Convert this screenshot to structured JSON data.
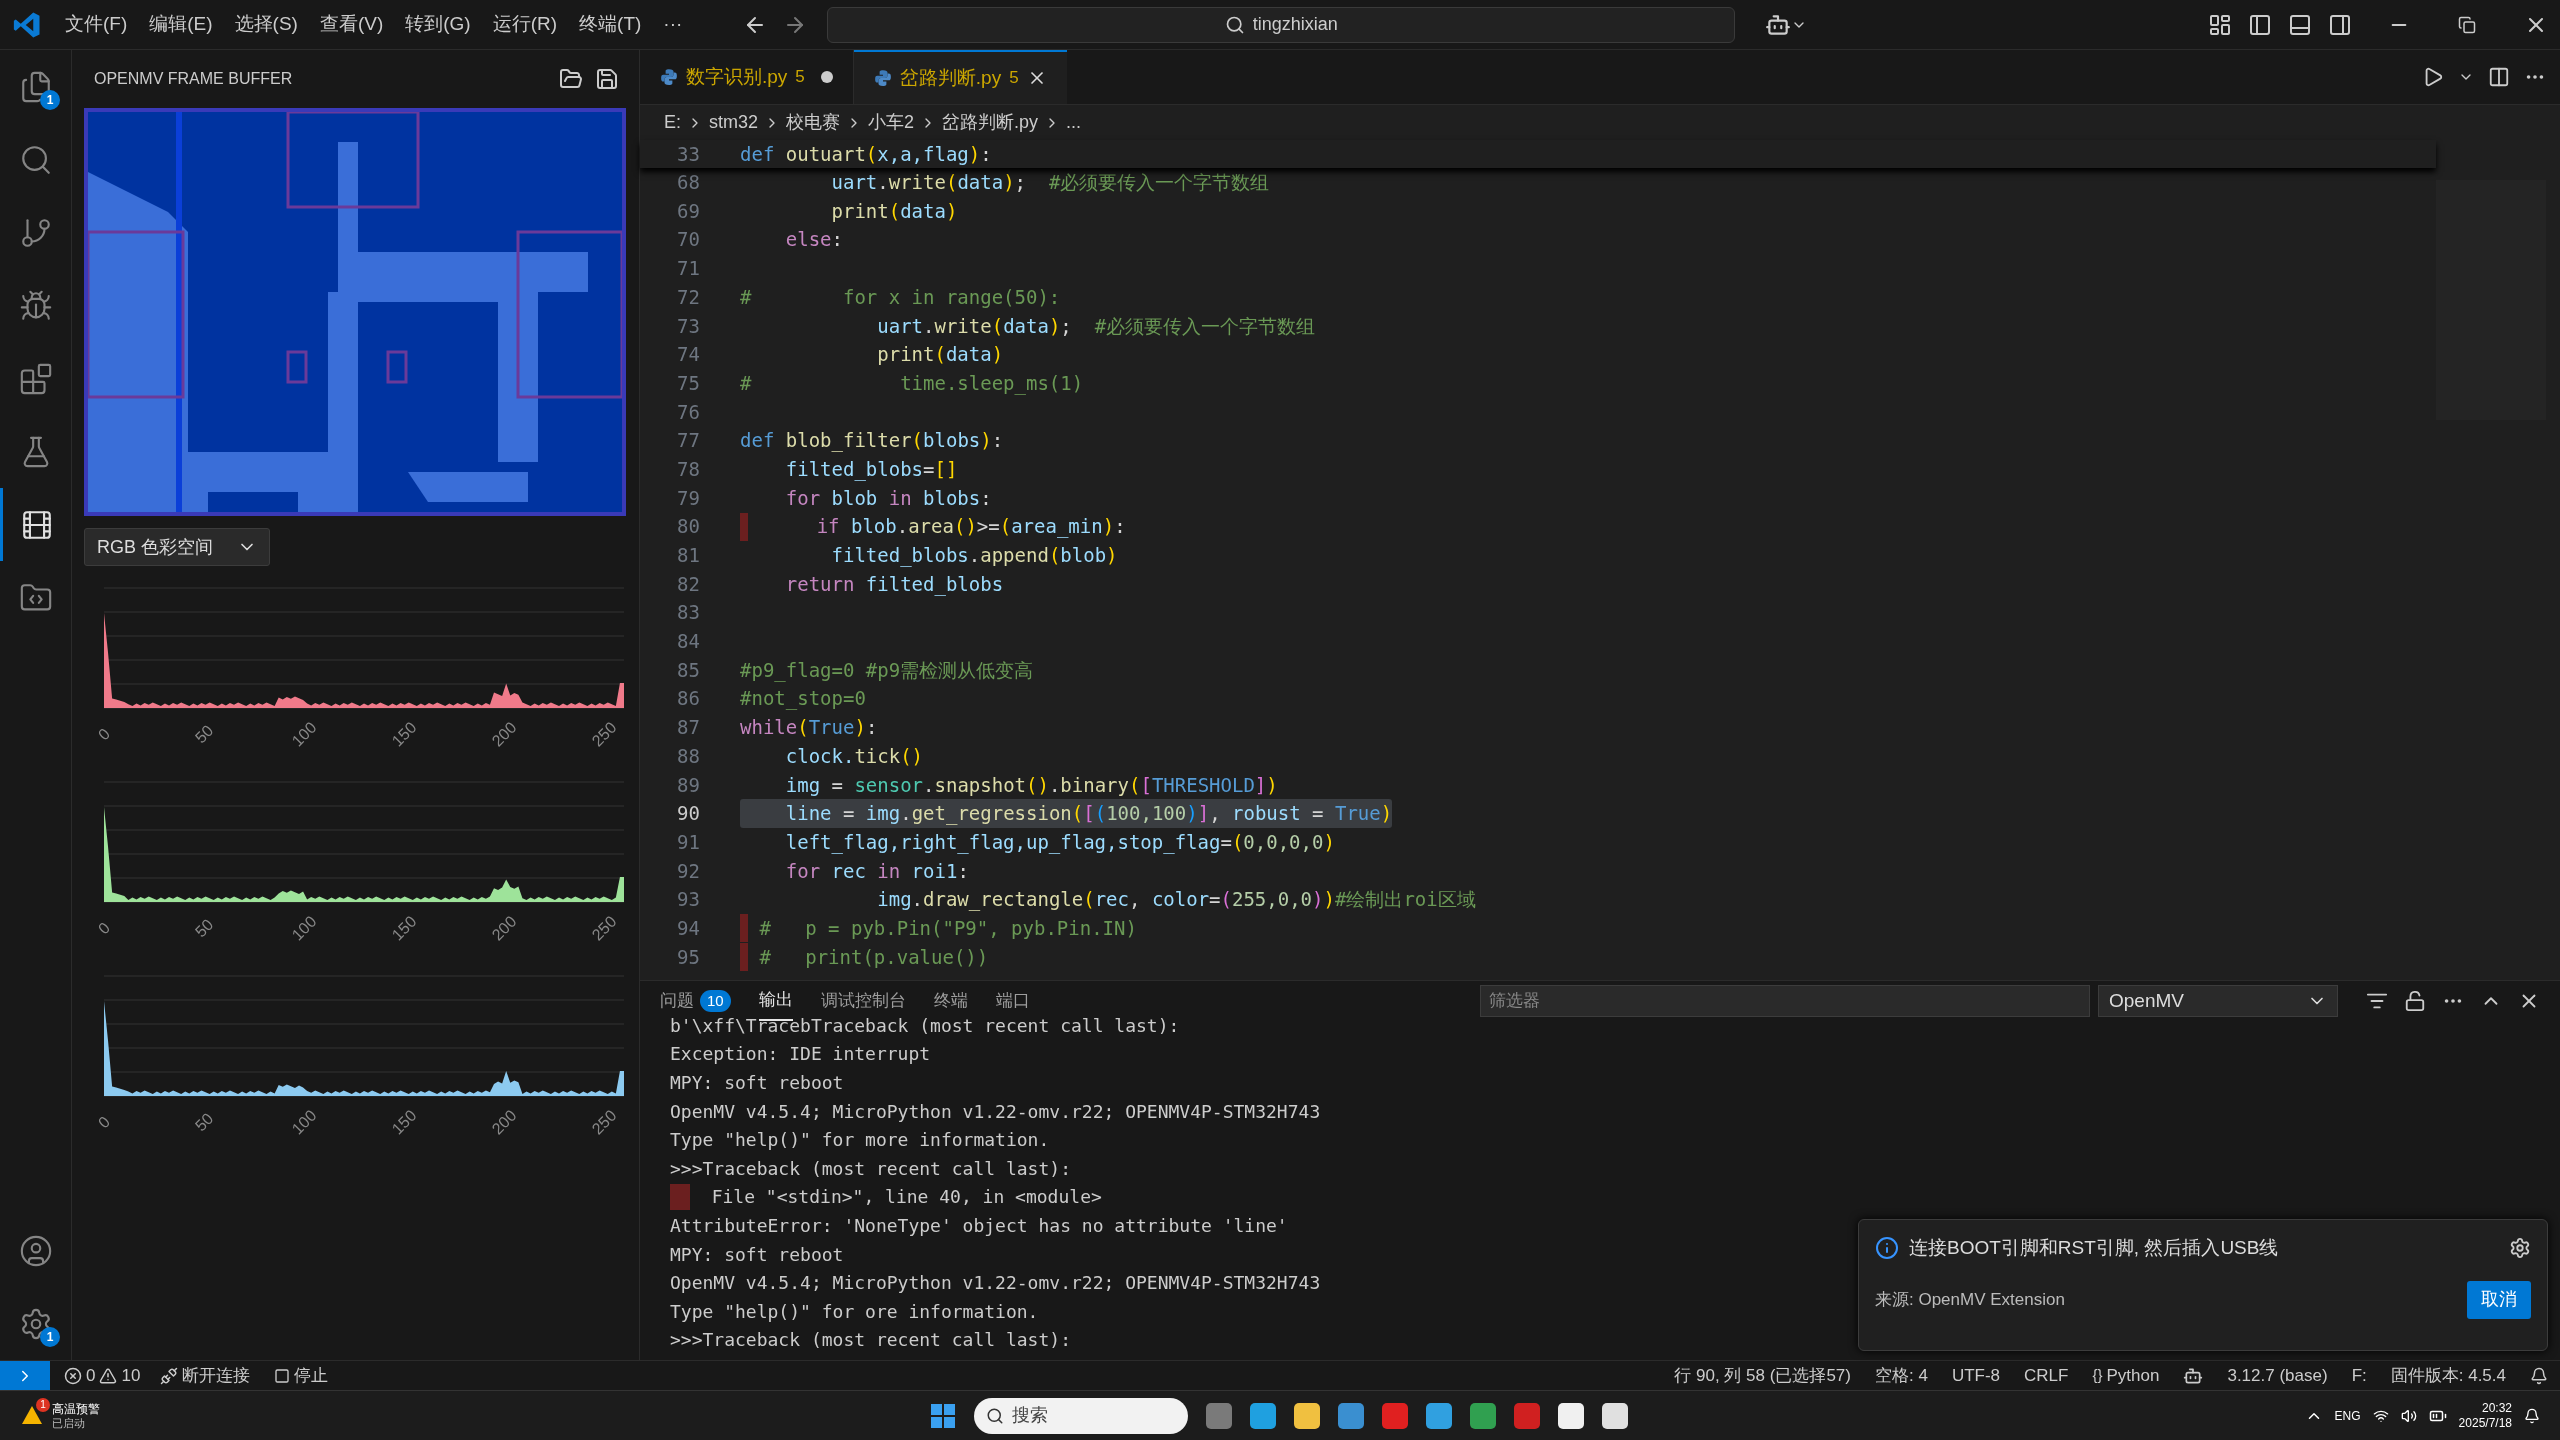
{
  "menu": [
    "文件(F)",
    "编辑(E)",
    "选择(S)",
    "查看(V)",
    "转到(G)",
    "运行(R)",
    "终端(T)",
    "···"
  ],
  "command_center": {
    "value": "tingzhixian"
  },
  "activity_bar": [
    {
      "kind": "files",
      "badge": "1",
      "selected": false
    },
    {
      "kind": "search",
      "selected": false
    },
    {
      "kind": "branch",
      "selected": false
    },
    {
      "kind": "debug",
      "selected": false
    },
    {
      "kind": "extensions",
      "selected": false
    },
    {
      "kind": "flask",
      "selected": false
    },
    {
      "kind": "film",
      "selected": true
    },
    {
      "kind": "remote",
      "selected": false
    }
  ],
  "activity_bottom": [
    {
      "kind": "account"
    },
    {
      "kind": "settings",
      "badge": "1"
    }
  ],
  "side_panel": {
    "title": "OPENMV FRAME BUFFER",
    "color_space": "RGB 色彩空间",
    "histograms": [
      {
        "color": "#f07a8a",
        "x_ticks": [
          "0",
          "50",
          "100",
          "150",
          "200",
          "250"
        ]
      },
      {
        "color": "#9ee39a",
        "x_ticks": [
          "0",
          "50",
          "100",
          "150",
          "200",
          "250"
        ]
      },
      {
        "color": "#8ccaf0",
        "x_ticks": [
          "0",
          "50",
          "100",
          "150",
          "200",
          "250"
        ]
      }
    ]
  },
  "tabs": [
    {
      "label": "数字识别.py",
      "problems": "5",
      "modified": true,
      "selected": false
    },
    {
      "label": "岔路判断.py",
      "problems": "5",
      "modified": false,
      "selected": true
    }
  ],
  "breadcrumb": [
    "E:",
    "stm32",
    "校电赛",
    "小车2",
    "岔路判断.py",
    "..."
  ],
  "sticky_line": {
    "number": "33",
    "segments": [
      {
        "text": "def ",
        "kind": "keyword"
      },
      {
        "text": "outuart",
        "kind": "func"
      },
      {
        "text": "(",
        "kind": "b1"
      },
      {
        "text": "x,a,flag",
        "kind": "var"
      },
      {
        "text": ")",
        "kind": "b1"
      },
      {
        "text": ":",
        "kind": "plain"
      }
    ]
  },
  "code_lines": [
    {
      "number": "68",
      "current": false,
      "error": false,
      "segments": [
        {
          "text": "        uart",
          "kind": "var"
        },
        {
          "text": ".",
          "kind": "plain"
        },
        {
          "text": "write",
          "kind": "func"
        },
        {
          "text": "(",
          "kind": "b1"
        },
        {
          "text": "data",
          "kind": "var"
        },
        {
          "text": ")",
          "kind": "b1"
        },
        {
          "text": ";  ",
          "kind": "plain"
        },
        {
          "text": "#必须要传入一个字节数组",
          "kind": "comment"
        }
      ]
    },
    {
      "number": "69",
      "current": false,
      "error": false,
      "segments": [
        {
          "text": "        print",
          "kind": "func"
        },
        {
          "text": "(",
          "kind": "b1"
        },
        {
          "text": "data",
          "kind": "var"
        },
        {
          "text": ")",
          "kind": "b1"
        }
      ]
    },
    {
      "number": "70",
      "current": false,
      "error": false,
      "segments": [
        {
          "text": "    else",
          "kind": "control"
        },
        {
          "text": ":",
          "kind": "plain"
        }
      ]
    },
    {
      "number": "71",
      "current": false,
      "error": false
    },
    {
      "number": "72",
      "current": false,
      "error": false,
      "segments": [
        {
          "text": "#        for x in range(50):",
          "kind": "comment"
        }
      ]
    },
    {
      "number": "73",
      "current": false,
      "error": false,
      "segments": [
        {
          "text": "            uart",
          "kind": "var"
        },
        {
          "text": ".",
          "kind": "plain"
        },
        {
          "text": "write",
          "kind": "func"
        },
        {
          "text": "(",
          "kind": "b1"
        },
        {
          "text": "data",
          "kind": "var"
        },
        {
          "text": ")",
          "kind": "b1"
        },
        {
          "text": ";  ",
          "kind": "plain"
        },
        {
          "text": "#必须要传入一个字节数组",
          "kind": "comment"
        }
      ]
    },
    {
      "number": "74",
      "current": false,
      "error": false,
      "segments": [
        {
          "text": "            print",
          "kind": "func"
        },
        {
          "text": "(",
          "kind": "b1"
        },
        {
          "text": "data",
          "kind": "var"
        },
        {
          "text": ")",
          "kind": "b1"
        }
      ]
    },
    {
      "number": "75",
      "current": false,
      "error": false,
      "segments": [
        {
          "text": "#             time.sleep_ms(1)",
          "kind": "comment"
        }
      ]
    },
    {
      "number": "76",
      "current": false,
      "error": false
    },
    {
      "number": "77",
      "current": false,
      "error": false,
      "segments": [
        {
          "text": "def ",
          "kind": "keyword"
        },
        {
          "text": "blob_filter",
          "kind": "func"
        },
        {
          "text": "(",
          "kind": "b1"
        },
        {
          "text": "blobs",
          "kind": "var"
        },
        {
          "text": ")",
          "kind": "b1"
        },
        {
          "text": ":",
          "kind": "plain"
        }
      ]
    },
    {
      "number": "78",
      "current": false,
      "error": false,
      "segments": [
        {
          "text": "    filted_blobs",
          "kind": "var"
        },
        {
          "text": "=",
          "kind": "plain"
        },
        {
          "text": "[]",
          "kind": "b1"
        }
      ]
    },
    {
      "number": "79",
      "current": false,
      "error": false,
      "segments": [
        {
          "text": "    for ",
          "kind": "control"
        },
        {
          "text": "blob ",
          "kind": "var"
        },
        {
          "text": "in ",
          "kind": "control"
        },
        {
          "text": "blobs",
          "kind": "var"
        },
        {
          "text": ":",
          "kind": "plain"
        }
      ]
    },
    {
      "number": "80",
      "current": false,
      "error": true,
      "segments": [
        {
          "text": "      if ",
          "kind": "control"
        },
        {
          "text": "blob",
          "kind": "var"
        },
        {
          "text": ".",
          "kind": "plain"
        },
        {
          "text": "area",
          "kind": "func"
        },
        {
          "text": "()",
          "kind": "b1"
        },
        {
          "text": ">=",
          "kind": "plain"
        },
        {
          "text": "(",
          "kind": "b1"
        },
        {
          "text": "area_min",
          "kind": "var"
        },
        {
          "text": ")",
          "kind": "b1"
        },
        {
          "text": ":",
          "kind": "plain"
        }
      ]
    },
    {
      "number": "81",
      "current": false,
      "error": false,
      "segments": [
        {
          "text": "        filted_blobs",
          "kind": "var"
        },
        {
          "text": ".",
          "kind": "plain"
        },
        {
          "text": "append",
          "kind": "func"
        },
        {
          "text": "(",
          "kind": "b1"
        },
        {
          "text": "blob",
          "kind": "var"
        },
        {
          "text": ")",
          "kind": "b1"
        }
      ]
    },
    {
      "number": "82",
      "current": false,
      "error": false,
      "segments": [
        {
          "text": "    return ",
          "kind": "control"
        },
        {
          "text": "filted_blobs",
          "kind": "var"
        }
      ]
    },
    {
      "number": "83",
      "current": false,
      "error": false
    },
    {
      "number": "84",
      "current": false,
      "error": false
    },
    {
      "number": "85",
      "current": false,
      "error": false,
      "segments": [
        {
          "text": "#p9_flag=0 #p9需检测从低变高",
          "kind": "comment"
        }
      ]
    },
    {
      "number": "86",
      "current": false,
      "error": false,
      "segments": [
        {
          "text": "#not_stop=0",
          "kind": "comment"
        }
      ]
    },
    {
      "number": "87",
      "current": false,
      "error": false,
      "segments": [
        {
          "text": "while",
          "kind": "control"
        },
        {
          "text": "(",
          "kind": "b1"
        },
        {
          "text": "True",
          "kind": "keyword"
        },
        {
          "text": ")",
          "kind": "b1"
        },
        {
          "text": ":",
          "kind": "plain"
        }
      ]
    },
    {
      "number": "88",
      "current": false,
      "error": false,
      "segments": [
        {
          "text": "    clock.",
          "kind": "var"
        },
        {
          "text": "tick",
          "kind": "func"
        },
        {
          "text": "()",
          "kind": "b1"
        }
      ]
    },
    {
      "number": "89",
      "current": false,
      "error": false,
      "segments": [
        {
          "text": "    img ",
          "kind": "var"
        },
        {
          "text": "= ",
          "kind": "plain"
        },
        {
          "text": "sensor",
          "kind": "class"
        },
        {
          "text": ".",
          "kind": "plain"
        },
        {
          "text": "snapshot",
          "kind": "func"
        },
        {
          "text": "()",
          "kind": "b1"
        },
        {
          "text": ".",
          "kind": "plain"
        },
        {
          "text": "binary",
          "kind": "func"
        },
        {
          "text": "(",
          "kind": "b1"
        },
        {
          "text": "[",
          "kind": "b2"
        },
        {
          "text": "THRESHOLD",
          "kind": "keyword"
        },
        {
          "text": "]",
          "kind": "b2"
        },
        {
          "text": ")",
          "kind": "b1"
        }
      ]
    },
    {
      "number": "90",
      "current": true,
      "error": false,
      "segments": [
        {
          "text": "    line ",
          "kind": "var"
        },
        {
          "text": "= ",
          "kind": "plain"
        },
        {
          "text": "img",
          "kind": "var"
        },
        {
          "text": ".",
          "kind": "plain"
        },
        {
          "text": "get_regression",
          "kind": "func"
        },
        {
          "text": "(",
          "kind": "b1"
        },
        {
          "text": "[",
          "kind": "b2"
        },
        {
          "text": "(",
          "kind": "b3"
        },
        {
          "text": "100,100",
          "kind": "number"
        },
        {
          "text": ")",
          "kind": "b3"
        },
        {
          "text": "]",
          "kind": "b2"
        },
        {
          "text": ", ",
          "kind": "plain"
        },
        {
          "text": "robust ",
          "kind": "var"
        },
        {
          "text": "= ",
          "kind": "plain"
        },
        {
          "text": "True",
          "kind": "keyword"
        },
        {
          "text": ")",
          "kind": "b1"
        }
      ]
    },
    {
      "number": "91",
      "current": false,
      "error": false,
      "segments": [
        {
          "text": "    left_flag,right_flag,up_flag,stop_flag",
          "kind": "var"
        },
        {
          "text": "=",
          "kind": "plain"
        },
        {
          "text": "(",
          "kind": "b1"
        },
        {
          "text": "0,0,0,0",
          "kind": "number"
        },
        {
          "text": ")",
          "kind": "b1"
        }
      ]
    },
    {
      "number": "92",
      "current": false,
      "error": false,
      "segments": [
        {
          "text": "    for ",
          "kind": "control"
        },
        {
          "text": "rec ",
          "kind": "var"
        },
        {
          "text": "in ",
          "kind": "control"
        },
        {
          "text": "roi1",
          "kind": "var"
        },
        {
          "text": ":",
          "kind": "plain"
        }
      ]
    },
    {
      "number": "93",
      "current": false,
      "error": false,
      "segments": [
        {
          "text": "            img",
          "kind": "var"
        },
        {
          "text": ".",
          "kind": "plain"
        },
        {
          "text": "draw_rectangle",
          "kind": "func"
        },
        {
          "text": "(",
          "kind": "b1"
        },
        {
          "text": "rec",
          "kind": "var"
        },
        {
          "text": ", ",
          "kind": "plain"
        },
        {
          "text": "color",
          "kind": "var"
        },
        {
          "text": "=",
          "kind": "plain"
        },
        {
          "text": "(",
          "kind": "b2"
        },
        {
          "text": "255,0,0",
          "kind": "number"
        },
        {
          "text": ")",
          "kind": "b2"
        },
        {
          "text": ")",
          "kind": "b1"
        },
        {
          "text": "#绘制出roi区域",
          "kind": "comment"
        }
      ]
    },
    {
      "number": "94",
      "current": false,
      "error": true,
      "segments": [
        {
          "text": " #   p = pyb.Pin(\"P9\", pyb.Pin.IN)",
          "kind": "comment"
        }
      ]
    },
    {
      "number": "95",
      "current": false,
      "error": true,
      "segments": [
        {
          "text": " #   print(p.value())",
          "kind": "comment"
        }
      ]
    }
  ],
  "panel": {
    "tabs": [
      {
        "label": "问题",
        "badge": "10",
        "selected": false
      },
      {
        "label": "输出",
        "selected": true
      },
      {
        "label": "调试控制台",
        "selected": false
      },
      {
        "label": "终端",
        "selected": false
      },
      {
        "label": "端口",
        "selected": false
      }
    ],
    "filter": {
      "placeholder": "筛选器"
    },
    "channel": "OpenMV",
    "output": [
      {
        "text": "b'\\xff\\TracebTraceback (most recent call last):",
        "error": false
      },
      {
        "text": "Exception: IDE interrupt",
        "error": false
      },
      {
        "text": "MPY: soft reboot",
        "error": false
      },
      {
        "text": "OpenMV v4.5.4; MicroPython v1.22-omv.r22; OPENMV4P-STM32H743",
        "error": false
      },
      {
        "text": "Type \"help()\" for more information.",
        "error": false
      },
      {
        "text": ">>>Traceback (most recent call last):",
        "error": false
      },
      {
        "text": "  File \"<stdin>\", line 40, in <module>",
        "error": true
      },
      {
        "text": "AttributeError: 'NoneType' object has no attribute 'line'",
        "error": false
      },
      {
        "text": "MPY: soft reboot",
        "error": false
      },
      {
        "text": "OpenMV v4.5.4; MicroPython v1.22-omv.r22; OPENMV4P-STM32H743",
        "error": false
      },
      {
        "text": "Type \"help()\" for ore information.",
        "error": false
      },
      {
        "text": ">>>Traceback (most recent call last):",
        "error": false
      }
    ]
  },
  "notification": {
    "message": "连接BOOT引脚和RST引脚, 然后插入USB线",
    "source": "来源: OpenMV Extension",
    "button": "取消"
  },
  "status_bar": {
    "errors": "0",
    "warnings": "10",
    "disconnect": "断开连接",
    "stop": "停止",
    "right": [
      {
        "kind": "text",
        "text": "行 90, 列 58 (已选择57)"
      },
      {
        "kind": "text",
        "text": "空格: 4"
      },
      {
        "kind": "text",
        "text": "UTF-8"
      },
      {
        "kind": "text",
        "text": "CRLF"
      },
      {
        "kind": "braces",
        "icon": "{}",
        "text": "Python"
      },
      {
        "kind": "copilot"
      },
      {
        "kind": "text",
        "text": "3.12.7 (base)"
      },
      {
        "kind": "text",
        "text": "F:"
      },
      {
        "kind": "text",
        "text": "固件版本: 4.5.4"
      },
      {
        "kind": "bell"
      }
    ]
  },
  "taskbar": {
    "weather_badge": "1",
    "weather_title": "高温预警",
    "weather_sub": "已启动",
    "search": {
      "placeholder": "搜索"
    },
    "lang": "ENG",
    "time": "20:32",
    "date": "2025/7/18"
  }
}
